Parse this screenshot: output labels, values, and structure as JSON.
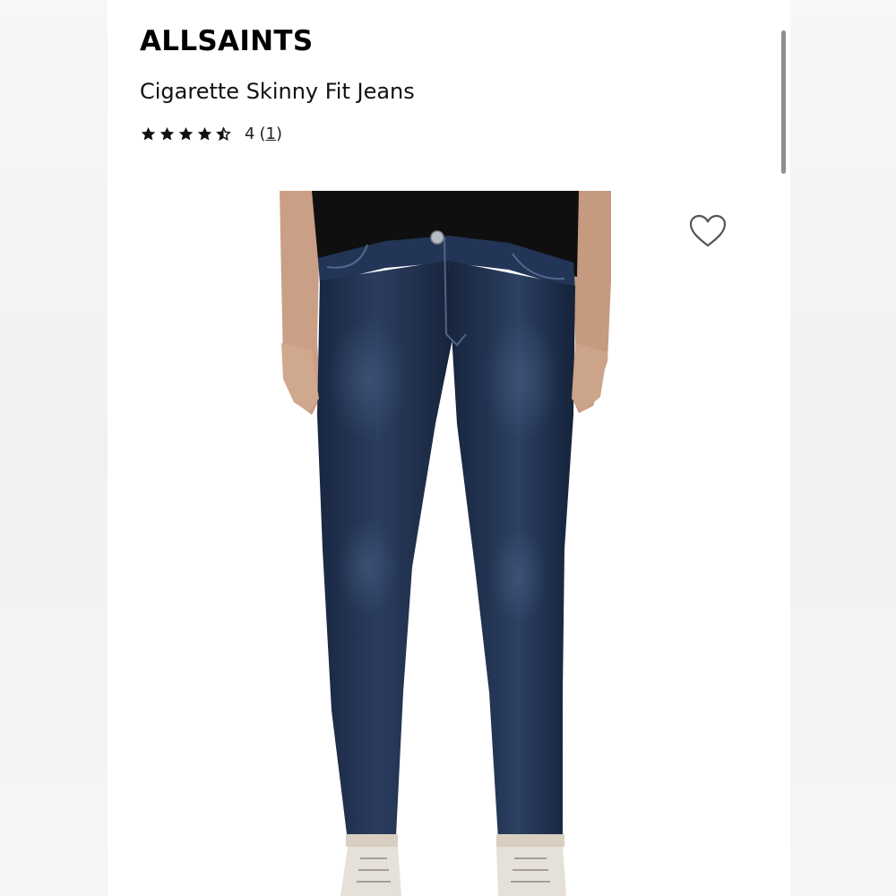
{
  "brand": "ALLSAINTS",
  "product": {
    "name": "Cigarette Skinny Fit Jeans",
    "rating_value": "4",
    "rating_stars": 4,
    "rating_max": 5,
    "review_count_open": "(",
    "review_count": "1",
    "review_count_close": ")"
  },
  "icons": {
    "wishlist": "heart-outline-icon",
    "star_filled": "star-filled-icon",
    "star_empty": "star-outline-icon"
  },
  "colors": {
    "denim": "#1d2c47",
    "text": "#111111",
    "background": "#ffffff"
  }
}
